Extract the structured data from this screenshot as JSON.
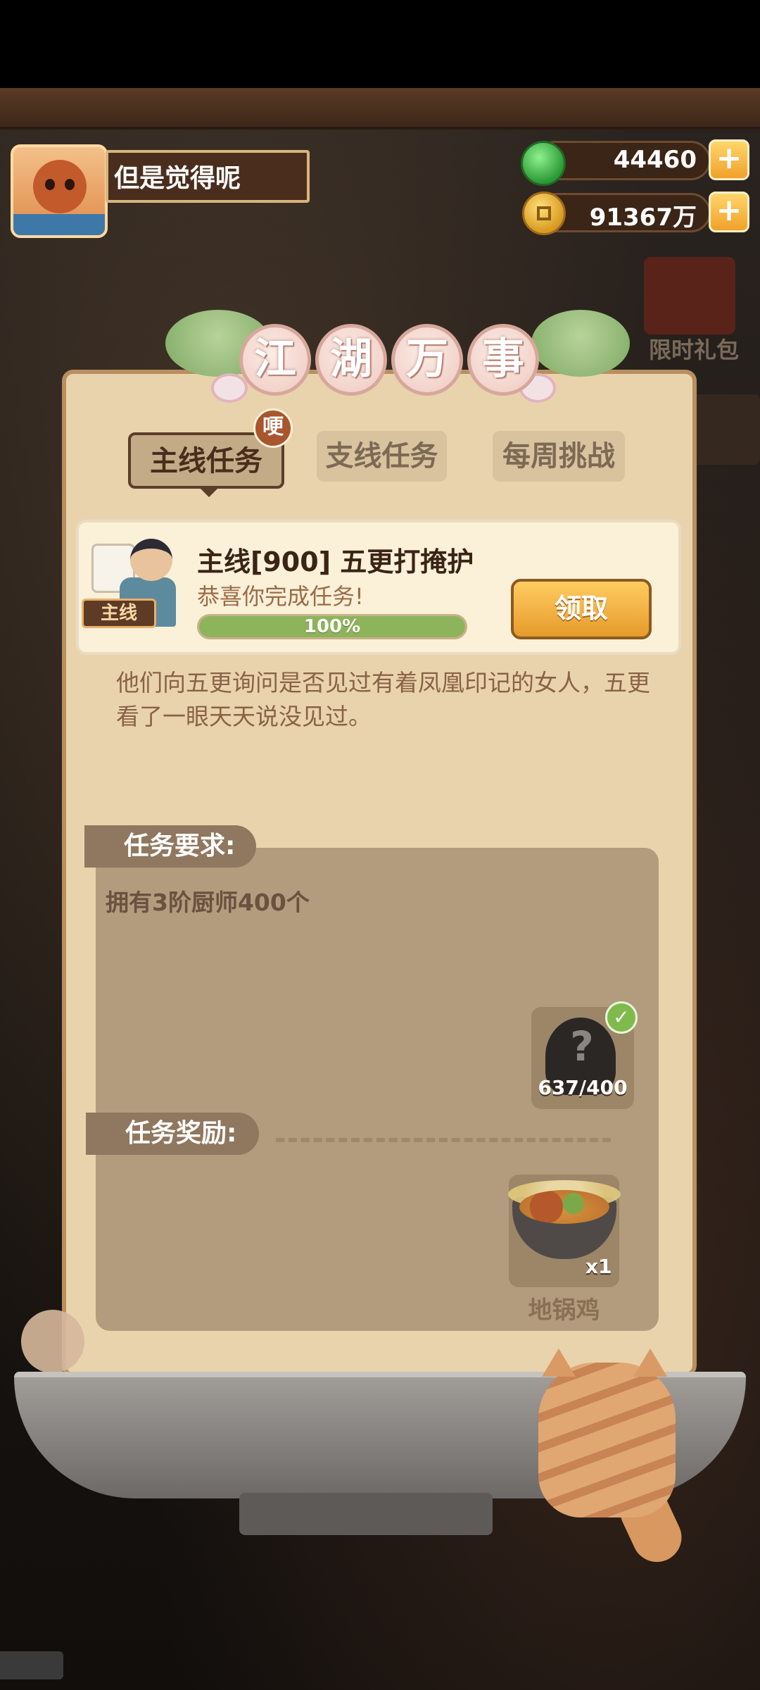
{
  "player": {
    "name": "但是觉得呢"
  },
  "currency": {
    "gems": "44460",
    "coins": "91367万",
    "plus": "+"
  },
  "promo": {
    "label": "限时礼包"
  },
  "title": {
    "chars": [
      "江",
      "湖",
      "万",
      "事"
    ]
  },
  "tabs": {
    "main": "主线任务",
    "side": "支线任务",
    "weekly": "每周挑战",
    "badge": "哽"
  },
  "quest": {
    "tag": "主线",
    "title": "主线[900] 五更打掩护",
    "subtitle": "恭喜你完成任务!",
    "progress_percent": 100,
    "progress_text": "100%",
    "claim_label": "领取",
    "description": "他们向五更询问是否见过有着凤凰印记的女人，五更看了一眼天天说没见过。"
  },
  "requirement": {
    "label": "任务要求:",
    "text": "拥有3阶厨师400个",
    "question_mark": "?",
    "count": "637/400",
    "check": "✓"
  },
  "reward": {
    "label": "任务奖励:",
    "item_name": "地锅鸡",
    "quantity": "x1"
  },
  "colors": {
    "panel_bg": "#e9d3ad",
    "claim_button": "#f0a12a",
    "progress_fill": "#8db45a",
    "section_box": "#b39b7e"
  }
}
